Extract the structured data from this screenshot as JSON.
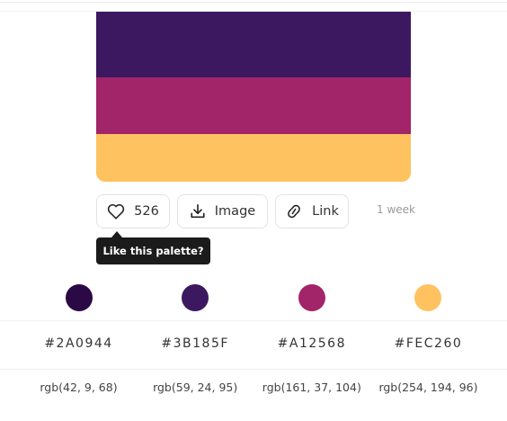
{
  "palette": {
    "colors": [
      {
        "hex": "#3B185F",
        "fill": "#3B185F"
      },
      {
        "hex": "#A12568",
        "fill": "#A12568"
      },
      {
        "hex": "#FEC260",
        "fill": "#FEC260"
      }
    ]
  },
  "actions": {
    "like_count": "526",
    "image_label": "Image",
    "link_label": "Link",
    "posted_ago": "1 week"
  },
  "tooltip": {
    "text": "Like this palette?"
  },
  "swatches": [
    {
      "hex": "#2A0944",
      "rgb": "rgb(42, 9, 68)",
      "color": "#2A0944"
    },
    {
      "hex": "#3B185F",
      "rgb": "rgb(59, 24, 95)",
      "color": "#3B185F"
    },
    {
      "hex": "#A12568",
      "rgb": "rgb(161, 37, 104)",
      "color": "#A12568"
    },
    {
      "hex": "#FEC260",
      "rgb": "rgb(254, 194, 96)",
      "color": "#FEC260"
    }
  ]
}
